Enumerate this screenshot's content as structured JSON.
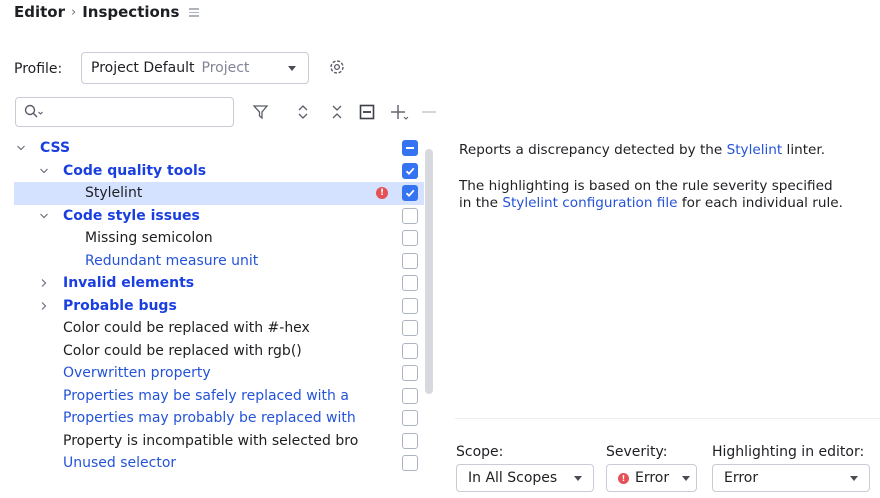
{
  "breadcrumb": {
    "parent": "Editor",
    "separator": "›",
    "current": "Inspections"
  },
  "profile": {
    "label": "Profile:",
    "value": "Project Default",
    "sub": "Project"
  },
  "search": {
    "placeholder": ""
  },
  "tree": {
    "rows": [
      {
        "label": "CSS",
        "kind": "group",
        "color": "blue",
        "expanded": true,
        "checkbox": "mixed"
      },
      {
        "label": "Code quality tools",
        "kind": "group",
        "color": "blue",
        "expanded": true,
        "checkbox": "checked"
      },
      {
        "label": "Stylelint",
        "kind": "item",
        "color": "black",
        "selected": true,
        "error_icon": true,
        "checkbox": "checked"
      },
      {
        "label": "Code style issues",
        "kind": "group",
        "color": "blue",
        "expanded": true,
        "checkbox": "unchecked"
      },
      {
        "label": "Missing semicolon",
        "kind": "item",
        "color": "black",
        "checkbox": "unchecked"
      },
      {
        "label": "Redundant measure unit",
        "kind": "item",
        "color": "blue",
        "checkbox": "unchecked"
      },
      {
        "label": "Invalid elements",
        "kind": "group",
        "color": "blue",
        "expanded": false,
        "checkbox": "unchecked"
      },
      {
        "label": "Probable bugs",
        "kind": "group",
        "color": "blue",
        "expanded": false,
        "checkbox": "unchecked"
      },
      {
        "label": "Color could be replaced with #-hex",
        "kind": "item",
        "color": "black",
        "checkbox": "unchecked"
      },
      {
        "label": "Color could be replaced with rgb()",
        "kind": "item",
        "color": "black",
        "checkbox": "unchecked"
      },
      {
        "label": "Overwritten property",
        "kind": "item",
        "color": "blue",
        "checkbox": "unchecked"
      },
      {
        "label": "Properties may be safely replaced with a",
        "kind": "item",
        "color": "blue",
        "checkbox": "unchecked"
      },
      {
        "label": "Properties may probably be replaced with",
        "kind": "item",
        "color": "blue",
        "checkbox": "unchecked"
      },
      {
        "label": "Property is incompatible with selected bro",
        "kind": "item",
        "color": "black",
        "checkbox": "unchecked"
      },
      {
        "label": "Unused selector",
        "kind": "item",
        "color": "blue",
        "checkbox": "unchecked"
      }
    ]
  },
  "description": {
    "line1_pre": "Reports a discrepancy detected by the ",
    "line1_link": "Stylelint",
    "line1_post": " linter.",
    "line2": "The highlighting is based on the rule severity specified",
    "line3_pre": "in the ",
    "line3_link": "Stylelint configuration file",
    "line3_post": " for each individual rule."
  },
  "bottom": {
    "scope_label": "Scope:",
    "scope_value": "In All Scopes",
    "severity_label": "Severity:",
    "severity_value": "Error",
    "highlight_label": "Highlighting in editor:",
    "highlight_value": "Error"
  },
  "colors": {
    "accent": "#3574f0",
    "link": "#2453d8",
    "selection": "#d4e2ff",
    "error": "#e55157"
  }
}
